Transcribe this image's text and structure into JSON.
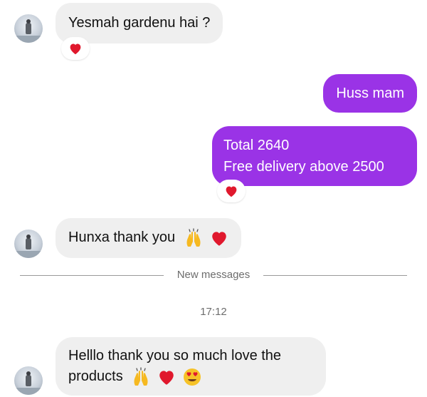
{
  "messages": [
    {
      "direction": "incoming",
      "text": "Yesmah gardenu hai ?",
      "reaction": "heart-icon"
    },
    {
      "direction": "outgoing",
      "text": "Huss mam"
    },
    {
      "direction": "outgoing",
      "lines": [
        "Total 2640",
        "Free delivery above 2500"
      ],
      "reaction": "heart-icon"
    },
    {
      "direction": "incoming",
      "text": "Hunxa thank you",
      "emojis": [
        "raised-hands-icon",
        "heart-icon"
      ]
    },
    {
      "direction": "incoming",
      "lines": [
        "Helllo thank you so much love the",
        "products"
      ],
      "emojis": [
        "raised-hands-icon",
        "heart-icon",
        "heart-eyes-icon"
      ]
    }
  ],
  "divider": {
    "label": "New messages"
  },
  "timestamp": "17:12",
  "colors": {
    "outgoing_bubble": "#9a33e6",
    "incoming_bubble": "#efefef",
    "heart": "#e0182d"
  }
}
